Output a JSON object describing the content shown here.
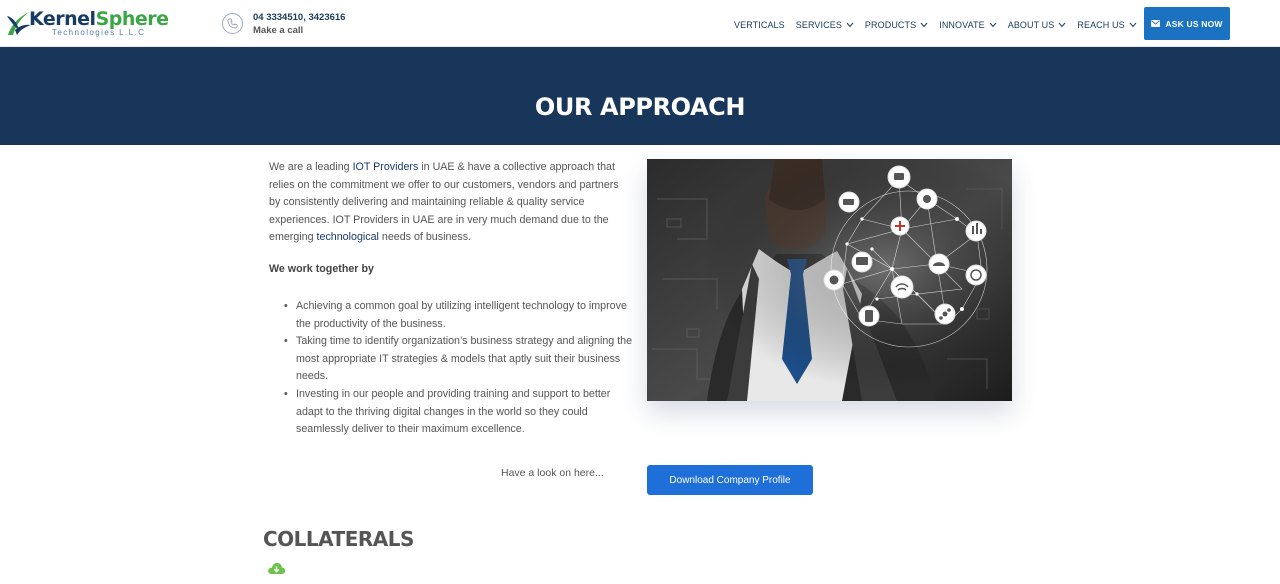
{
  "header": {
    "logo": {
      "brand_part1": "Kernel",
      "brand_part2": "Sphere",
      "tagline": "Technologies L.L.C"
    },
    "phone": {
      "number": "04 3334510, 3423616",
      "note": "Make a call",
      "icon": "phone-icon"
    },
    "nav": [
      {
        "label": "VERTICALS",
        "dropdown": false
      },
      {
        "label": "SERVICES",
        "dropdown": true
      },
      {
        "label": "PRODUCTS",
        "dropdown": true
      },
      {
        "label": "INNOVATE",
        "dropdown": true
      },
      {
        "label": "ABOUT US",
        "dropdown": true
      },
      {
        "label": "REACH US",
        "dropdown": true
      }
    ],
    "ask_button": {
      "label": "ASK US NOW",
      "icon": "mail-icon"
    }
  },
  "banner": {
    "title": "OUR APPROACH"
  },
  "content": {
    "intro": {
      "t1": "We are a leading ",
      "link1": "IOT Providers",
      "t2": " in UAE & have a collective approach that relies on the commitment we offer to our customers, vendors and partners by consistently delivering and maintaining reliable & quality service experiences. IOT Providers in UAE are in very much demand due to the emerging ",
      "link2": "technological",
      "t3": " needs of business."
    },
    "subheading": "We work together by",
    "points": [
      "Achieving a common goal by utilizing intelligent technology to improve the productivity of the business.",
      "Taking time to identify organization’s business strategy and aligning the most appropriate IT strategies & models that aptly suit their business needs.",
      "Investing in our people and providing training and support to better adapt to the thriving digital changes in the world so they could seamlessly deliver to their maximum excellence."
    ],
    "image_alt": "businessman-with-iot-network-icons",
    "cta_text": "Have a look on here...",
    "cta_button": "Download Company Profile",
    "collaterals_title": "COLLATERALS",
    "collaterals_icon": "cloud-download-icon"
  },
  "colors": {
    "brand_navy": "#17365a",
    "brand_green": "#3aa645",
    "button_blue": "#1b72c0",
    "cta_blue": "#1f6fd8",
    "cloud_green": "#6cc24a"
  }
}
